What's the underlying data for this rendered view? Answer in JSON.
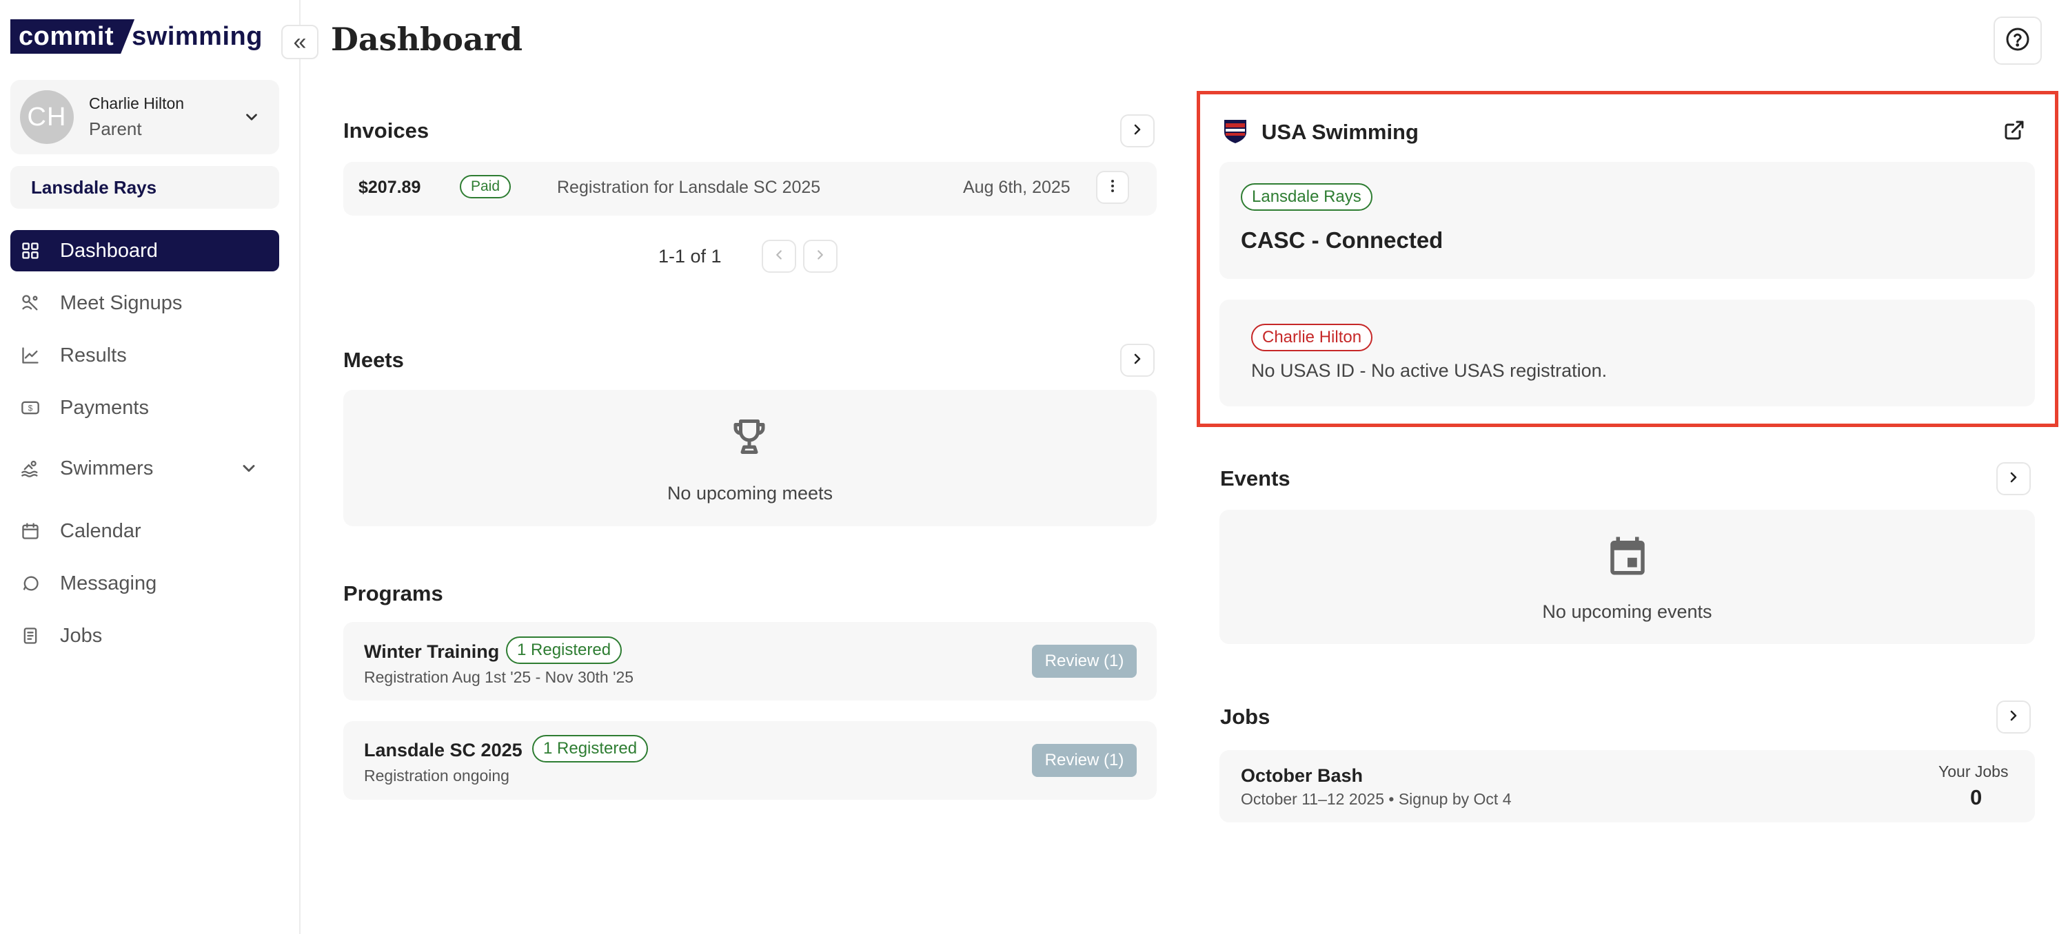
{
  "brand": {
    "part1": "commit",
    "part2": "swimming"
  },
  "user": {
    "initials": "CH",
    "name": "Charlie Hilton",
    "role": "Parent"
  },
  "team": "Lansdale Rays",
  "nav": {
    "dashboard": "Dashboard",
    "meet_signups": "Meet Signups",
    "results": "Results",
    "payments": "Payments",
    "swimmers": "Swimmers",
    "calendar": "Calendar",
    "messaging": "Messaging",
    "jobs": "Jobs"
  },
  "header": {
    "collapse": "«",
    "title": "Dashboard"
  },
  "invoices": {
    "title": "Invoices",
    "row": {
      "amount": "$207.89",
      "status": "Paid",
      "description": "Registration for Lansdale SC 2025",
      "date": "Aug 6th, 2025"
    },
    "pagination": "1-1 of 1"
  },
  "meets": {
    "title": "Meets",
    "empty": "No upcoming meets"
  },
  "programs": {
    "title": "Programs",
    "items": [
      {
        "name": "Winter Training",
        "badge": "1 Registered",
        "sub": "Registration Aug 1st '25 - Nov 30th '25",
        "action": "Review (1)"
      },
      {
        "name": "Lansdale SC 2025",
        "badge": "1 Registered",
        "sub": "Registration ongoing",
        "action": "Review (1)"
      }
    ]
  },
  "usa_swimming": {
    "title": "USA Swimming",
    "club_badge": "Lansdale Rays",
    "club_status": "CASC - Connected",
    "swimmer_badge": "Charlie Hilton",
    "swimmer_status": "No USAS ID - No active USAS registration."
  },
  "events": {
    "title": "Events",
    "empty": "No upcoming events"
  },
  "jobs": {
    "title": "Jobs",
    "item": {
      "name": "October Bash",
      "sub": "October 11–12 2025 • Signup by Oct 4",
      "count_label": "Your Jobs",
      "count": "0"
    }
  },
  "colors": {
    "brand_navy": "#14134a",
    "paid_green": "#2e7d32",
    "alert_red": "#c62828",
    "highlight": "#e8402e",
    "review_button": "#a3b8c2"
  },
  "icons": [
    "dashboard-grid-icon",
    "meet-signups-icon",
    "results-chart-icon",
    "payments-dollar-icon",
    "swimmers-icon",
    "calendar-icon",
    "messaging-icon",
    "jobs-clipboard-icon",
    "trophy-icon",
    "calendar-event-icon",
    "help-circle-icon",
    "external-link-icon",
    "chevron-right-icon",
    "chevron-down-icon",
    "more-vertical-icon"
  ]
}
